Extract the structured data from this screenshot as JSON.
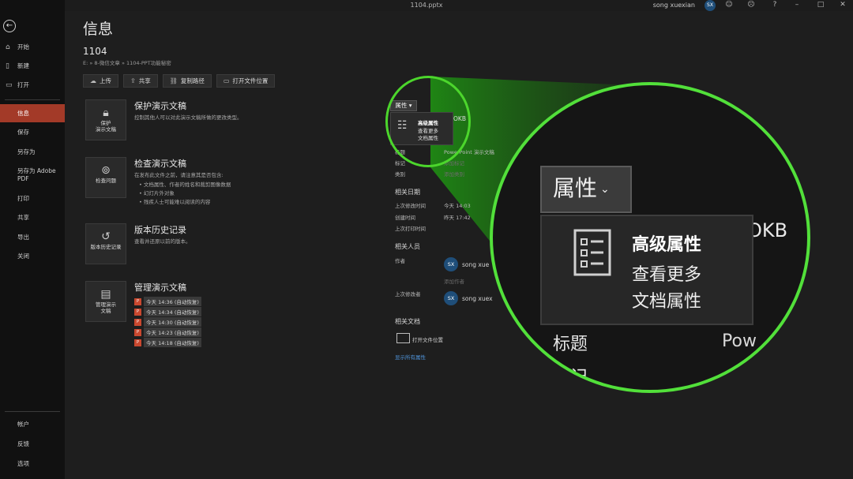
{
  "window": {
    "file_name": "1104.pptx",
    "user_name": "song xuexian",
    "user_initials": "SX"
  },
  "nav": {
    "items": [
      {
        "label": "开始",
        "icon": "home-icon"
      },
      {
        "label": "新建",
        "icon": "new-file-icon"
      },
      {
        "label": "打开",
        "icon": "open-folder-icon"
      },
      {
        "label": "信息"
      },
      {
        "label": "保存"
      },
      {
        "label": "另存为"
      },
      {
        "label": "另存为 Adobe PDF"
      },
      {
        "label": "打印"
      },
      {
        "label": "共享"
      },
      {
        "label": "导出"
      },
      {
        "label": "关闭"
      }
    ],
    "bottom": [
      {
        "label": "帐户"
      },
      {
        "label": "反馈"
      },
      {
        "label": "选项"
      }
    ]
  },
  "main": {
    "title": "信息",
    "doc_title": "1104",
    "doc_path": "E: » 8-微信文章 » 1104-PPT功能秘密",
    "actions": [
      {
        "label": "上传",
        "icon": "upload-icon"
      },
      {
        "label": "共享",
        "icon": "share-icon"
      },
      {
        "label": "复制路径",
        "icon": "link-icon"
      },
      {
        "label": "打开文件位置",
        "icon": "folder-icon"
      }
    ],
    "protect": {
      "tile": "保护\n演示文稿",
      "title": "保护演示文稿",
      "desc": "控制其他人可以对此演示文稿所做的更改类型。"
    },
    "inspect": {
      "tile": "检查问题",
      "title": "检查演示文稿",
      "desc": "在发布此文件之前，请注意其是否包含:",
      "bullets": [
        "文档属性、作者的姓名和裁剪图像数据",
        "幻灯片外对象",
        "残疾人士可能难以阅读的内容"
      ]
    },
    "history": {
      "tile": "版本历史记录",
      "title": "版本历史记录",
      "desc": "查看并还原以前的版本。"
    },
    "manage": {
      "tile": "管理演示\n文稿",
      "title": "管理演示文稿",
      "versions": [
        "今天 14:36 (自动恢复)",
        "今天 14:34 (自动恢复)",
        "今天 14:30 (自动恢复)",
        "今天 14:23 (自动恢复)",
        "今天 14:18 (自动恢复)"
      ]
    }
  },
  "properties": {
    "button": "属性",
    "menu_title": "高级属性",
    "menu_desc_line1": "查看更多",
    "menu_desc_line2": "文档属性",
    "size_fragment": "OKB",
    "title_label": "标题",
    "title_value": "PowerPoint 演示文稿",
    "tags_label": "标记",
    "tags_value": "添加标记",
    "category_label": "类别",
    "category_value": "添加类别",
    "dates_heading": "相关日期",
    "modified_label": "上次修改时间",
    "modified_value": "今天 14:03",
    "created_label": "创建时间",
    "created_value": "昨天 17:42",
    "printed_label": "上次打印时间",
    "people_heading": "相关人员",
    "author_label": "作者",
    "author_name": "song xue",
    "add_author": "添加作者",
    "modifier_label": "上次修改者",
    "modifier_name": "song xuex",
    "docs_heading": "相关文档",
    "open_location": "打开文件位置",
    "show_all": "显示所有属性"
  },
  "magnified": {
    "button": "属性",
    "menu_title": "高级属性",
    "menu_desc_line1": "查看更多",
    "menu_desc_line2": "文档属性",
    "size_fragment": "OKB",
    "label1": "标题",
    "label2": "示记",
    "value1": "Pow"
  },
  "colors": {
    "nav_active": "#a33a28",
    "highlight": "#52e03a",
    "link": "#4f93d8"
  }
}
